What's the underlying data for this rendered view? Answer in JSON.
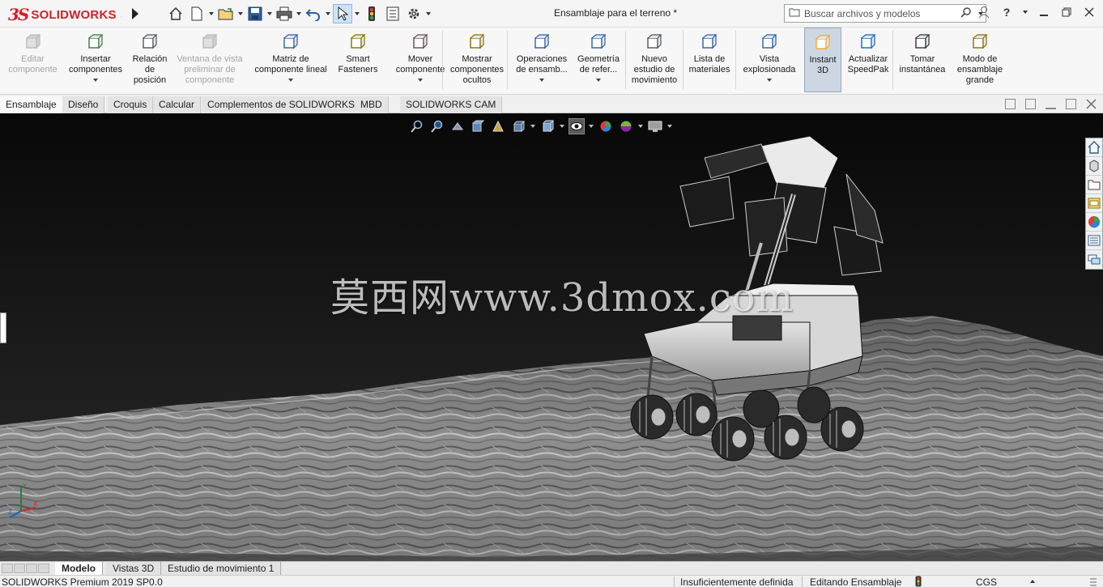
{
  "app": {
    "brand_ds": "3S",
    "brand_name": "SOLIDWORKS",
    "document_title": "Ensamblaje para el terreno *"
  },
  "search": {
    "placeholder": "Buscar archivos y modelos"
  },
  "ribbon": [
    {
      "label": "Editar\ncomponente",
      "icon": "edit-component-icon",
      "disabled": true
    },
    {
      "label": "Insertar\ncomponentes",
      "icon": "insert-components-icon",
      "dropdown": true
    },
    {
      "label": "Relación\nde\nposición",
      "icon": "mate-icon"
    },
    {
      "label": "Ventana de vista\npreliminar de\ncomponente",
      "icon": "preview-window-icon",
      "disabled": true
    },
    {
      "label": "Matriz de\ncomponente lineal",
      "icon": "linear-pattern-icon",
      "dropdown": true
    },
    {
      "label": "Smart\nFasteners",
      "icon": "smart-fasteners-icon"
    },
    {
      "label": "Mover\ncomponente",
      "icon": "move-component-icon",
      "dropdown": true
    },
    {
      "label": "Mostrar\ncomponentes\nocultos",
      "icon": "show-hidden-icon"
    },
    {
      "label": "Operaciones\nde ensamb...",
      "icon": "assembly-features-icon",
      "dropdown": true
    },
    {
      "label": "Geometría\nde refer...",
      "icon": "reference-geometry-icon",
      "dropdown": true
    },
    {
      "label": "Nuevo\nestudio de\nmovimiento",
      "icon": "motion-study-icon"
    },
    {
      "label": "Lista de\nmateriales",
      "icon": "bom-icon"
    },
    {
      "label": "Vista\nexplosionada",
      "icon": "exploded-view-icon",
      "dropdown": true
    },
    {
      "label": "Instant\n3D",
      "icon": "instant3d-icon",
      "active": true
    },
    {
      "label": "Actualizar\nSpeedPak",
      "icon": "speedpak-icon"
    },
    {
      "label": "Tomar\ninstantánea",
      "icon": "snapshot-icon"
    },
    {
      "label": "Modo de\nensamblaje\ngrande",
      "icon": "large-assembly-icon"
    }
  ],
  "command_tabs": [
    "Ensamblaje",
    "Diseño",
    "Croquis",
    "Calcular",
    "Complementos de SOLIDWORKS",
    "MBD",
    "SOLIDWORKS CAM"
  ],
  "active_command_tab": "Ensamblaje",
  "watermark": "莫西网www.3dmox.com",
  "bottom_tabs": [
    "Modelo",
    "Vistas 3D",
    "Estudio de movimiento 1"
  ],
  "active_bottom_tab": "Modelo",
  "status": {
    "version": "SOLIDWORKS Premium 2019 SP0.0",
    "definition": "Insuficientemente definida",
    "mode": "Editando Ensamblaje",
    "units": "CGS"
  },
  "triad": {
    "x": "X",
    "y": "Y",
    "z": "Z"
  }
}
